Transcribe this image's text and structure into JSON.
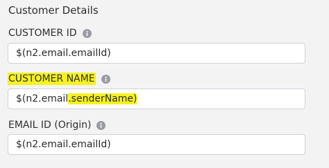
{
  "section": {
    "title": "Customer Details"
  },
  "fields": {
    "customer_id": {
      "label": "CUSTOMER ID",
      "value": "$(n2.email.emailId)"
    },
    "customer_name": {
      "label": "CUSTOMER NAME",
      "value_plain": "$(n2.email",
      "value_highlighted": ".senderName)"
    },
    "email_id": {
      "label": "EMAIL ID (Origin)",
      "value": "$(n2.email.emailId)"
    }
  },
  "icons": {
    "info": "info-circle-icon"
  },
  "colors": {
    "background": "#f3f3f4",
    "highlight": "#f5f222",
    "input_border": "#cfd2d6",
    "info_icon": "#9a9ca1"
  }
}
